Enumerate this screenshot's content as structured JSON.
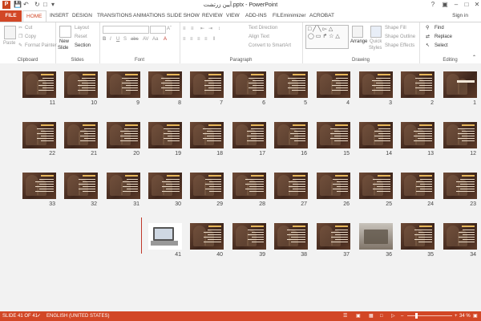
{
  "window": {
    "title": "آیین زرتشت.pptx - PowerPoint"
  },
  "tabs": [
    {
      "label": "FILE",
      "name": "tab-file"
    },
    {
      "label": "HOME",
      "name": "tab-home"
    },
    {
      "label": "INSERT",
      "name": "tab-insert"
    },
    {
      "label": "DESIGN",
      "name": "tab-design"
    },
    {
      "label": "TRANSITIONS",
      "name": "tab-transitions"
    },
    {
      "label": "ANIMATIONS",
      "name": "tab-animations"
    },
    {
      "label": "SLIDE SHOW",
      "name": "tab-slide-show"
    },
    {
      "label": "REVIEW",
      "name": "tab-review"
    },
    {
      "label": "VIEW",
      "name": "tab-view"
    },
    {
      "label": "ADD-INS",
      "name": "tab-add-ins"
    },
    {
      "label": "FILEminimizer",
      "name": "tab-fileminimizer"
    },
    {
      "label": "ACROBAT",
      "name": "tab-acrobat"
    }
  ],
  "signin": "Sign in",
  "ribbon": {
    "clipboard": {
      "label": "Clipboard",
      "paste": "Paste",
      "cut": "Cut",
      "copy": "Copy",
      "format_painter": "Format Painter"
    },
    "slides": {
      "label": "Slides",
      "new_slide": "New",
      "new_slide2": "Slide",
      "layout": "Layout",
      "reset": "Reset",
      "section": "Section"
    },
    "font": {
      "label": "Font"
    },
    "paragraph": {
      "label": "Paragraph",
      "text_direction": "Text Direction",
      "align_text": "Align Text",
      "convert_smartart": "Convert to SmartArt"
    },
    "drawing": {
      "label": "Drawing",
      "arrange": "Arrange",
      "quick_styles": "Quick",
      "quick_styles2": "Styles",
      "shape_fill": "Shape Fill",
      "shape_outline": "Shape Outline",
      "shape_effects": "Shape Effects"
    },
    "editing": {
      "label": "Editing",
      "find": "Find",
      "replace": "Replace",
      "select": "Select"
    }
  },
  "slides": [
    {
      "n": "1",
      "kind": "title"
    },
    {
      "n": "2",
      "kind": "text"
    },
    {
      "n": "3",
      "kind": "text"
    },
    {
      "n": "4",
      "kind": "text"
    },
    {
      "n": "5",
      "kind": "text"
    },
    {
      "n": "6",
      "kind": "text"
    },
    {
      "n": "7",
      "kind": "text"
    },
    {
      "n": "8",
      "kind": "text"
    },
    {
      "n": "9",
      "kind": "text"
    },
    {
      "n": "10",
      "kind": "text"
    },
    {
      "n": "11",
      "kind": "text"
    },
    {
      "n": "12",
      "kind": "text"
    },
    {
      "n": "13",
      "kind": "text"
    },
    {
      "n": "14",
      "kind": "text"
    },
    {
      "n": "15",
      "kind": "text"
    },
    {
      "n": "16",
      "kind": "text"
    },
    {
      "n": "17",
      "kind": "text"
    },
    {
      "n": "18",
      "kind": "text"
    },
    {
      "n": "19",
      "kind": "text"
    },
    {
      "n": "20",
      "kind": "text"
    },
    {
      "n": "21",
      "kind": "text"
    },
    {
      "n": "22",
      "kind": "text"
    },
    {
      "n": "23",
      "kind": "text"
    },
    {
      "n": "24",
      "kind": "text"
    },
    {
      "n": "25",
      "kind": "text"
    },
    {
      "n": "26",
      "kind": "text"
    },
    {
      "n": "27",
      "kind": "text"
    },
    {
      "n": "28",
      "kind": "text"
    },
    {
      "n": "29",
      "kind": "text"
    },
    {
      "n": "30",
      "kind": "text"
    },
    {
      "n": "31",
      "kind": "text"
    },
    {
      "n": "32",
      "kind": "text"
    },
    {
      "n": "33",
      "kind": "text"
    },
    {
      "n": "34",
      "kind": "text"
    },
    {
      "n": "35",
      "kind": "text"
    },
    {
      "n": "36",
      "kind": "photo"
    },
    {
      "n": "37",
      "kind": "text"
    },
    {
      "n": "38",
      "kind": "text"
    },
    {
      "n": "39",
      "kind": "text"
    },
    {
      "n": "40",
      "kind": "text"
    },
    {
      "n": "41",
      "kind": "laptop"
    }
  ],
  "status": {
    "slide": "SLIDE 41 OF 41",
    "language": "ENGLISH (UNITED STATES)",
    "zoom": "34 %",
    "zoom_level": 0.34
  }
}
